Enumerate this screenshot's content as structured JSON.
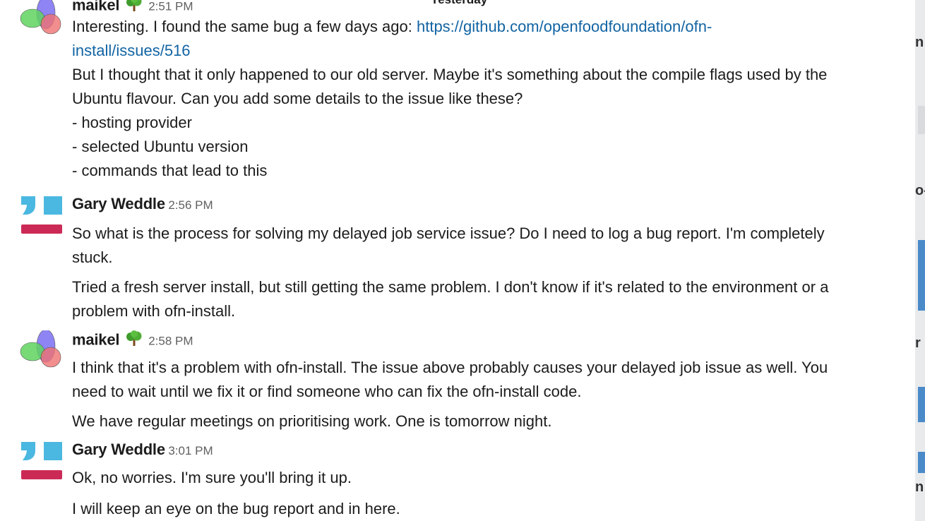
{
  "day_divider": "Yesterday",
  "messages": [
    {
      "author": "maikel",
      "avatar": "tri-circle-avatar-icon",
      "emoji": "tree-emoji-icon",
      "time": "2:51 PM",
      "line1_prefix": "Interesting. I found the same bug a few days ago: ",
      "link1": "https://github.com/openfoodfoundation/ofn-",
      "link2": "install/issues/516",
      "para2_line1": "But I thought that it only happened to our old server. Maybe it's something about the compile flags used by the",
      "para2_line2": "Ubuntu flavour. Can you add some details to the issue like these?",
      "bullet1": "- hosting provider",
      "bullet2": "- selected Ubuntu version",
      "bullet3": "- commands that lead to this"
    },
    {
      "author": "Gary Weddle",
      "avatar": "blocks-avatar-icon",
      "time": "2:56 PM",
      "p1_line1": "So what is the process for solving my delayed job service issue? Do I need to log a bug report. I'm completely",
      "p1_line2": "stuck.",
      "p2_line1": "Tried a fresh server install, but still getting the same problem. I don't know if it's related to the environment or a",
      "p2_line2": "problem with ofn-install."
    },
    {
      "author": "maikel",
      "avatar": "tri-circle-avatar-icon",
      "emoji": "tree-emoji-icon",
      "time": "2:58 PM",
      "p1_line1": "I think that it's a problem with ofn-install. The issue above probably causes your delayed job issue as well. You",
      "p1_line2": "need to wait until we fix it or find someone who can fix the ofn-install code.",
      "p2_line1": "We have regular meetings on prioritising work. One is tomorrow night."
    },
    {
      "author": "Gary Weddle",
      "avatar": "blocks-avatar-icon",
      "time": "3:01 PM",
      "p1_line1": "Ok, no worries. I'm sure you'll bring it up.",
      "p2_line1": "I will keep an eye on the bug report and in here."
    }
  ],
  "right_edge_fragments": [
    "n",
    "o-",
    "r",
    "n"
  ],
  "colors": {
    "link": "#1264a3",
    "timestamp": "#616061",
    "gary_blue": "#4ab8e0",
    "gary_red": "#cc2a56",
    "avatar_blue": "#6b6bf0",
    "avatar_green": "#5cd65c",
    "avatar_red": "#f07070"
  }
}
